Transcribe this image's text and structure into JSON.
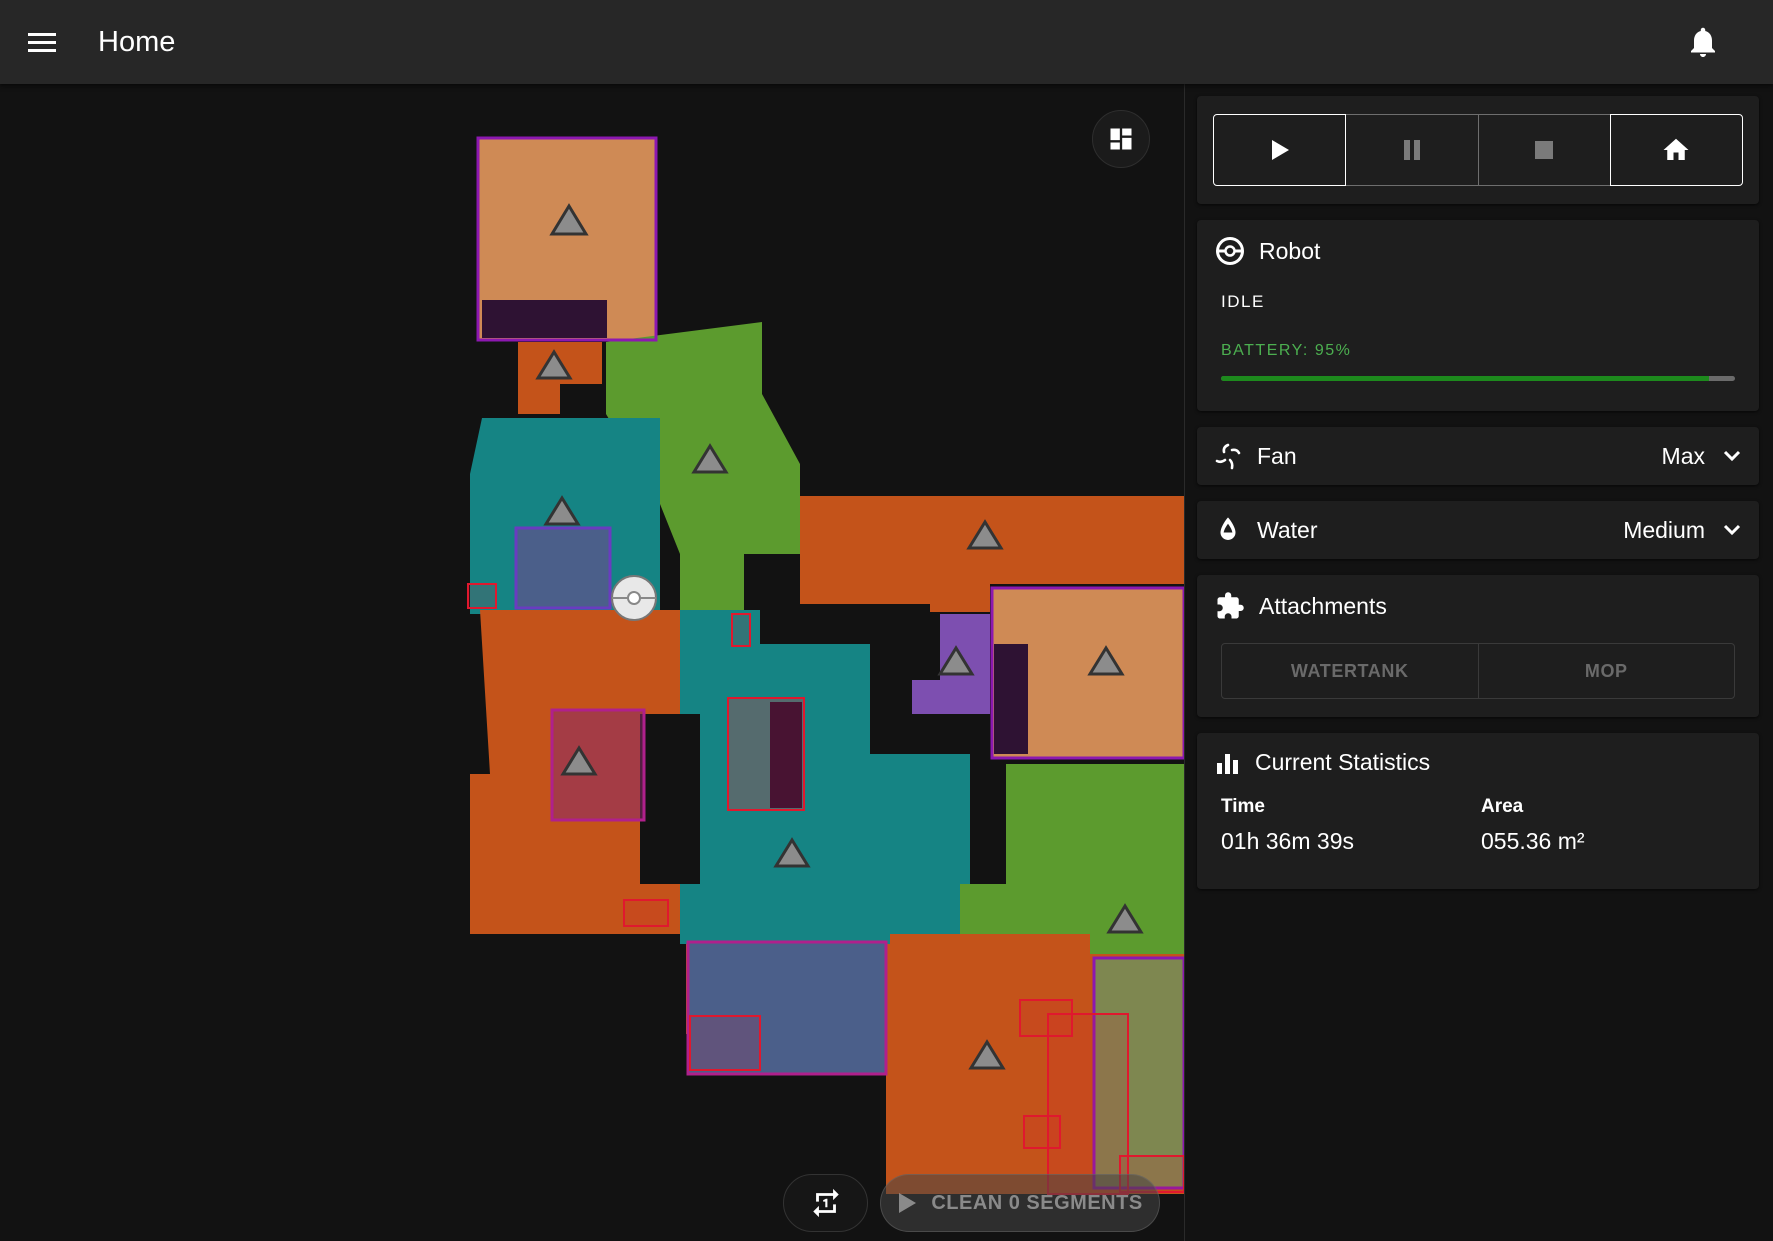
{
  "header": {
    "title": "Home",
    "menu_icon": "menu-icon",
    "notification_icon": "bell-icon"
  },
  "map": {
    "layout_button_icon": "dashboard-layout-icon",
    "iteration_button_icon": "repeat-once-icon",
    "iterations": "1",
    "clean_button_label": "CLEAN 0 SEGMENTS",
    "clean_button_icon": "play-icon",
    "colors": {
      "orange": "#c4531a",
      "tan": "#cf8a55",
      "teal": "#158484",
      "green": "#5c9b2e",
      "purple": "#7d4fb0",
      "slate": "#4b5f8a",
      "olive": "#7e8750",
      "dark_purple": "#2e1233",
      "segment_outline": "#8c18b0",
      "zone_red": "#e0182e"
    }
  },
  "controls": {
    "buttons": [
      {
        "name": "start",
        "icon": "play-icon",
        "active": true
      },
      {
        "name": "pause",
        "icon": "pause-icon",
        "active": false
      },
      {
        "name": "stop",
        "icon": "stop-icon",
        "active": false
      },
      {
        "name": "home",
        "icon": "home-icon",
        "active": true
      }
    ]
  },
  "robot": {
    "title": "Robot",
    "icon": "robot-vacuum-icon",
    "status": "IDLE",
    "battery_label": "BATTERY: 95%",
    "battery_percent": 95,
    "battery_color": "#4caf50"
  },
  "fan": {
    "label": "Fan",
    "icon": "fan-icon",
    "value": "Max"
  },
  "water": {
    "label": "Water",
    "icon": "water-drop-icon",
    "value": "Medium"
  },
  "attachments": {
    "title": "Attachments",
    "icon": "puzzle-icon",
    "items": [
      "WATERTANK",
      "MOP"
    ]
  },
  "statistics": {
    "title": "Current Statistics",
    "icon": "bar-chart-icon",
    "time_label": "Time",
    "time_value": "01h 36m 39s",
    "area_label": "Area",
    "area_value": "055.36 m²"
  }
}
